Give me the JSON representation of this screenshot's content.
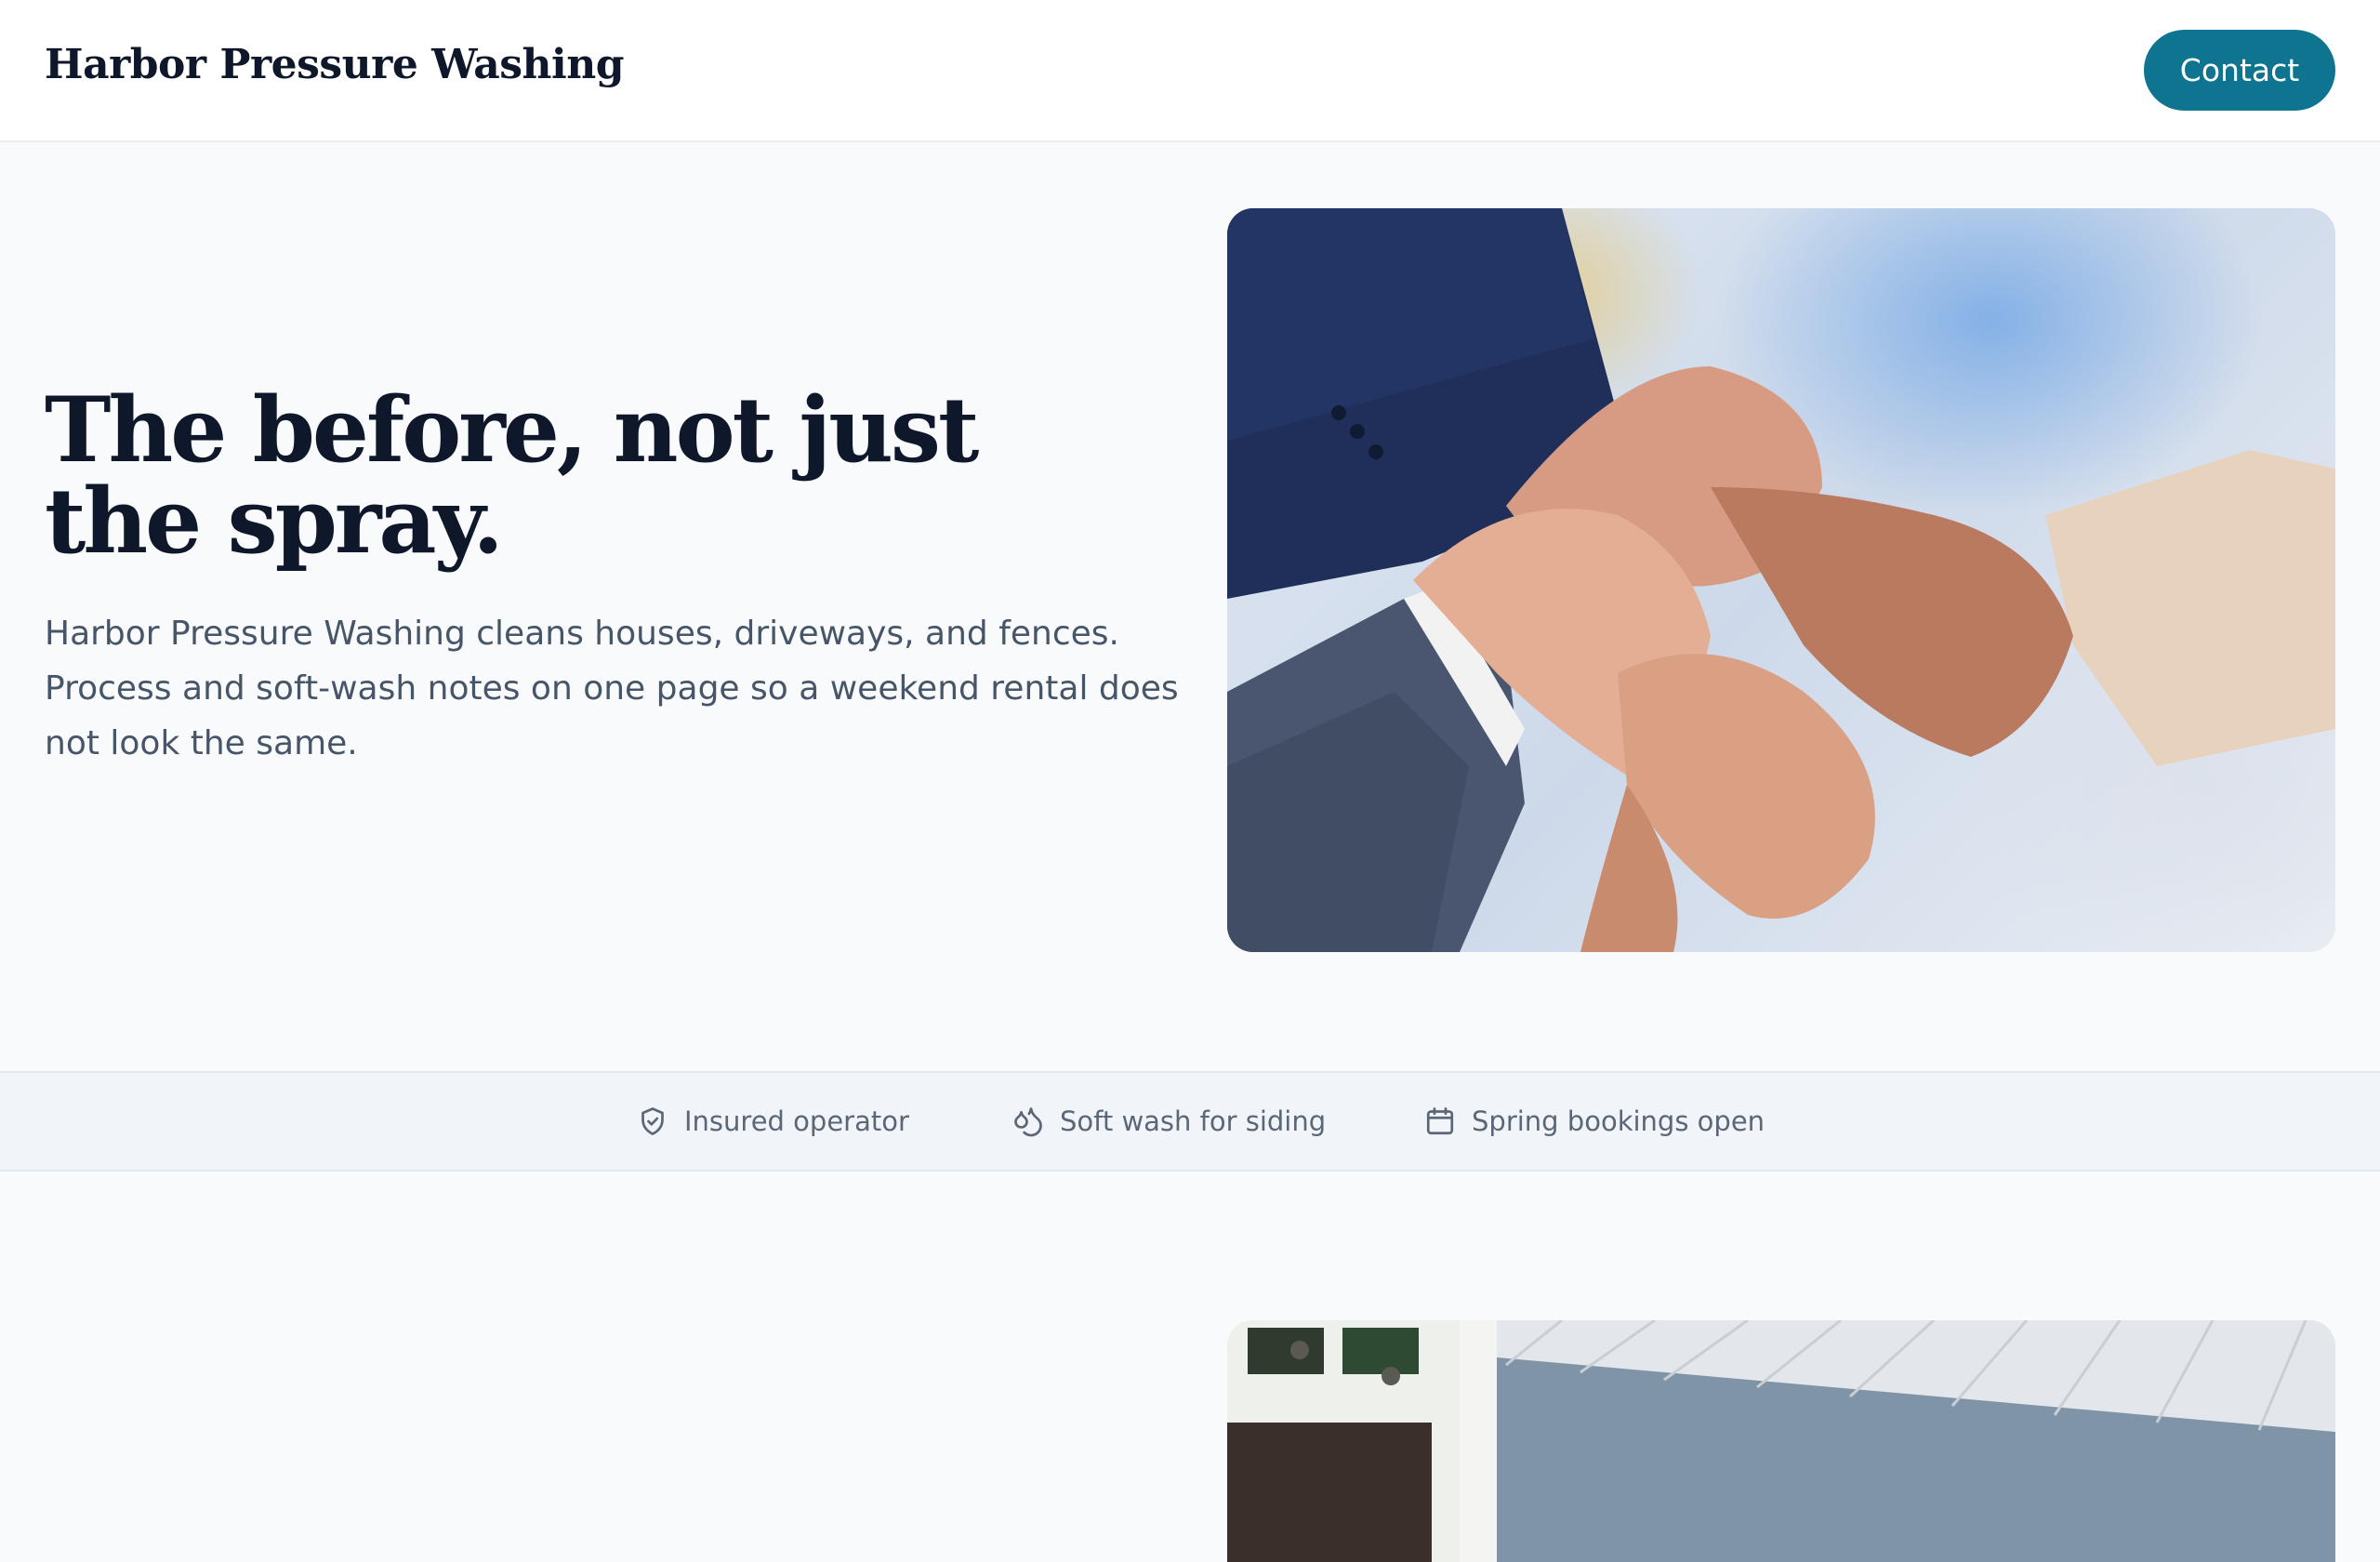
{
  "header": {
    "brand": "Harbor Pressure Washing",
    "contact_label": "Contact"
  },
  "hero": {
    "title": "The before, not just the spray.",
    "subtitle": "Harbor Pressure Washing cleans houses, driveways, and fences. Process and soft-wash notes on one page so a weekend rental does not look the same."
  },
  "trust": {
    "items": [
      {
        "icon": "shield-check-icon",
        "label": "Insured operator"
      },
      {
        "icon": "droplets-icon",
        "label": "Soft wash for siding"
      },
      {
        "icon": "calendar-icon",
        "label": "Spring bookings open"
      }
    ]
  },
  "colors": {
    "accent": "#0f7490",
    "heading": "#0f172a",
    "body_text": "#475569",
    "page_bg": "#f8fafc",
    "strip_bg": "#f1f5f9"
  }
}
